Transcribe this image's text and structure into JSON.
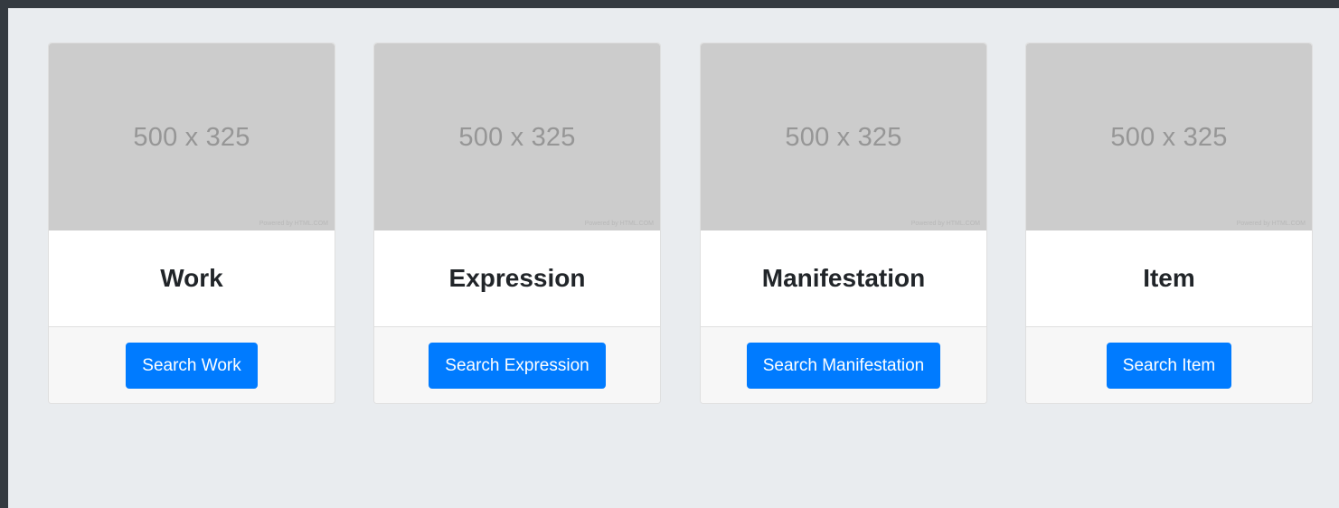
{
  "cards": [
    {
      "image_text": "500 x 325",
      "image_credit": "Powered by HTML.COM",
      "title": "Work",
      "button_label": "Search Work"
    },
    {
      "image_text": "500 x 325",
      "image_credit": "Powered by HTML.COM",
      "title": "Expression",
      "button_label": "Search Expression"
    },
    {
      "image_text": "500 x 325",
      "image_credit": "Powered by HTML.COM",
      "title": "Manifestation",
      "button_label": "Search Manifestation"
    },
    {
      "image_text": "500 x 325",
      "image_credit": "Powered by HTML.COM",
      "title": "Item",
      "button_label": "Search Item"
    }
  ],
  "colors": {
    "primary": "#007bff",
    "page_background": "#e9ecef",
    "top_bar": "#343a40",
    "placeholder": "#cccccc"
  }
}
